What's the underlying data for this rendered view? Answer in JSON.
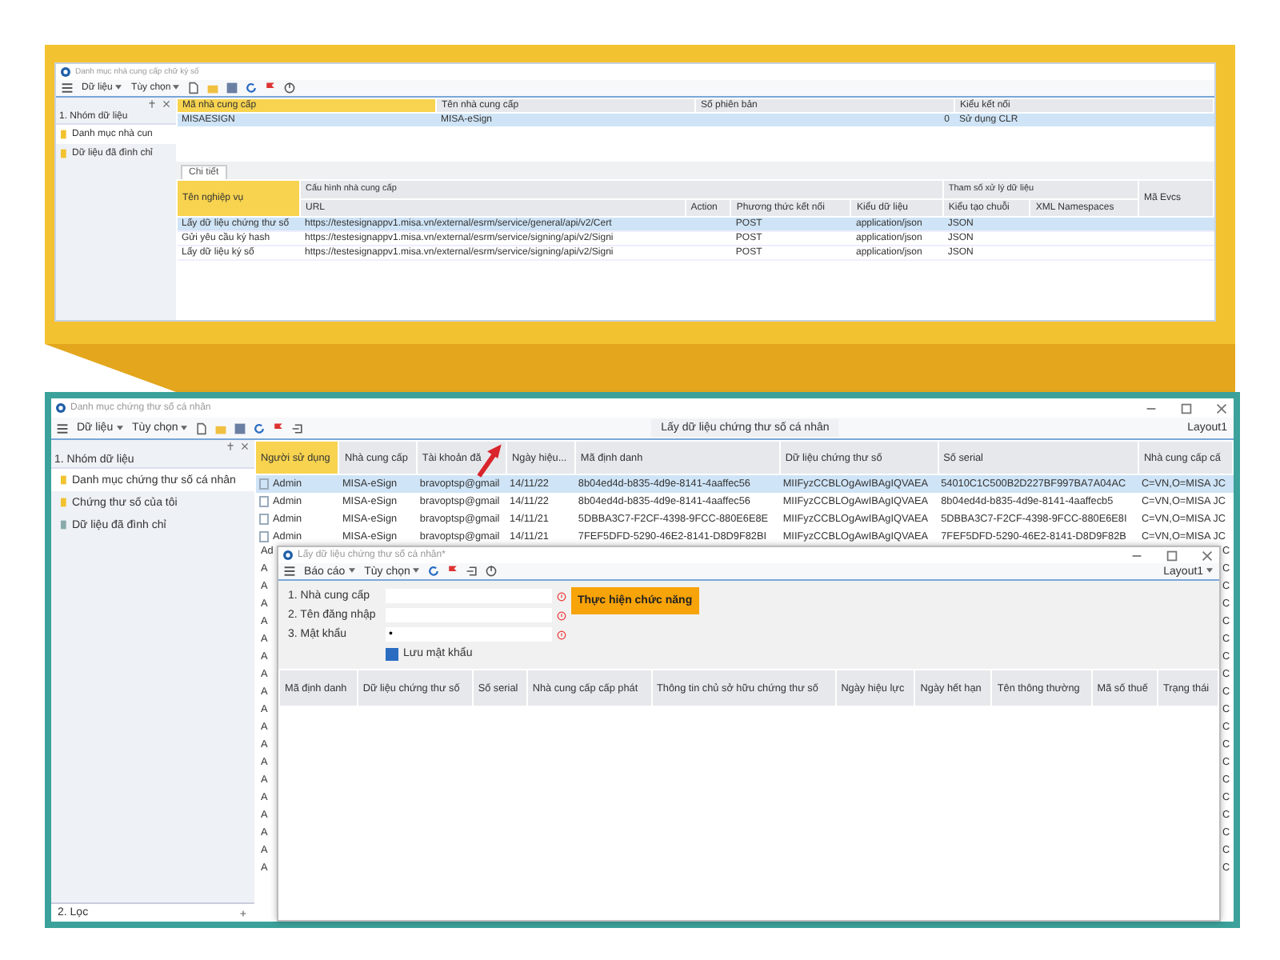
{
  "top_window": {
    "title": "Danh mục nhà cung cấp chữ ký số",
    "menu": [
      "Dữ liệu",
      "Tùy chọn"
    ],
    "sidebar": {
      "group": "1. Nhóm dữ liệu",
      "items": [
        {
          "label": "Danh mục nhà cun",
          "kind": "folder",
          "selected": true
        },
        {
          "label": "Dữ liệu đã đình chỉ",
          "kind": "folder",
          "selected": false
        }
      ]
    },
    "providers": {
      "columns": [
        {
          "label": "Mã nhà cung cấp",
          "highlighted": true
        },
        {
          "label": "Tên nhà cung cấp",
          "highlighted": false
        },
        {
          "label": "Số phiên bản",
          "highlighted": false
        },
        {
          "label": "Kiểu kết nối",
          "highlighted": false
        }
      ],
      "rows": [
        {
          "cells": [
            "MISAESIGN",
            "MISA-eSign",
            "0",
            "Sử dụng CLR"
          ],
          "selected": true
        }
      ]
    },
    "tab": {
      "label": "Chi tiết",
      "selected": true
    },
    "details": {
      "name_column": {
        "label": "Tên nghiệp vụ",
        "highlighted": true
      },
      "groups": [
        {
          "label": "Cấu hình nhà cung cấp",
          "columns": [
            "URL",
            "Action",
            "Phương thức kết nối",
            "Kiểu dữ liệu"
          ]
        },
        {
          "label": "Tham số xử lý dữ liệu",
          "columns": [
            "Kiểu tạo chuỗi",
            "XML Namespaces"
          ]
        }
      ],
      "code_column": "Mã Evcs",
      "rows": [
        {
          "name": "Lấy dữ liệu chứng thư số",
          "url": "https://testesignappv1.misa.vn/external/esrm/service/general/api/v2/Cert",
          "method": "POST",
          "data_type": "application/json",
          "string_type": "JSON",
          "selected": true
        },
        {
          "name": "Gửi yêu cầu ký hash",
          "url": "https://testesignappv1.misa.vn/external/esrm/service/signing/api/v2/Signi",
          "method": "POST",
          "data_type": "application/json",
          "string_type": "JSON",
          "selected": false
        },
        {
          "name": "Lấy dữ liệu ký số",
          "url": "https://testesignappv1.misa.vn/external/esrm/service/signing/api/v2/Signi",
          "method": "POST",
          "data_type": "application/json",
          "string_type": "JSON",
          "selected": false
        }
      ]
    }
  },
  "bottom_window": {
    "title": "Danh mục chứng thư số cá nhân",
    "menu": [
      "Dữ liệu",
      "Tùy chọn"
    ],
    "action": "Lấy dữ liệu chứng thư số cá nhân",
    "layout": "Layout1",
    "sidebar": {
      "group": "1. Nhóm dữ liệu",
      "items": [
        {
          "label": "Danh mục chứng thư số cá nhân",
          "kind": "folder",
          "selected": true
        },
        {
          "label": "Chứng thư số của tôi",
          "kind": "folder",
          "selected": false
        },
        {
          "label": "Dữ liệu đã đình chỉ",
          "kind": "suspended",
          "selected": false
        }
      ],
      "filter": "2. Lọc"
    },
    "grid": {
      "columns": [
        {
          "label": "Người sử dụng",
          "highlighted": true
        },
        {
          "label": "Nhà cung cấp",
          "highlighted": false
        },
        {
          "label": "Tài khoản đă",
          "highlighted": false
        },
        {
          "label": "Ngày hiệu...",
          "highlighted": false
        },
        {
          "label": "Mã định danh",
          "highlighted": false
        },
        {
          "label": "Dữ liệu chứng thư số",
          "highlighted": false
        },
        {
          "label": "Số serial",
          "highlighted": false
        },
        {
          "label": "Nhà cung cấp cấ",
          "highlighted": false
        }
      ],
      "rows": [
        {
          "cells": [
            "Admin",
            "MISA-eSign",
            "bravoptsp@gmail",
            "14/11/22",
            "8b04ed4d-b835-4d9e-8141-4aaffec56",
            "MIIFyzCCBLOgAwIBAgIQVAEA",
            "54010C1C500B2D227BF997BA7A04AC",
            "C=VN,O=MISA JC"
          ],
          "selected": true
        },
        {
          "cells": [
            "Admin",
            "MISA-eSign",
            "bravoptsp@gmail",
            "14/11/22",
            "8b04ed4d-b835-4d9e-8141-4aaffec56",
            "MIIFyzCCBLOgAwIBAgIQVAEA",
            "8b04ed4d-b835-4d9e-8141-4aaffecb5",
            "C=VN,O=MISA JC"
          ],
          "selected": false
        },
        {
          "cells": [
            "Admin",
            "MISA-eSign",
            "bravoptsp@gmail",
            "14/11/21",
            "5DBBA3C7-F2CF-4398-9FCC-880E6E8E",
            "MIIFyzCCBLOgAwIBAgIQVAEA",
            "5DBBA3C7-F2CF-4398-9FCC-880E6E8I",
            "C=VN,O=MISA JC"
          ],
          "selected": false
        },
        {
          "cells": [
            "Admin",
            "MISA-eSign",
            "bravoptsp@gmail",
            "14/11/21",
            "7FEF5DFD-5290-46E2-8141-D8D9F82BI",
            "MIIFyzCCBLOgAwIBAgIQVAEA",
            "7FEF5DFD-5290-46E2-8141-D8D9F82B",
            "C=VN,O=MISA JC"
          ],
          "selected": false
        }
      ],
      "covered_rows": [
        {
          "left": "Ad",
          "right": "C"
        },
        {
          "left": "A",
          "right": "C"
        },
        {
          "left": "A",
          "right": "C"
        },
        {
          "left": "A",
          "right": "C"
        },
        {
          "left": "A",
          "right": "C"
        },
        {
          "left": "A",
          "right": "C"
        },
        {
          "left": "A",
          "right": "C"
        },
        {
          "left": "A",
          "right": "C"
        },
        {
          "left": "A",
          "right": "C"
        },
        {
          "left": "A",
          "right": "C"
        },
        {
          "left": "A",
          "right": "C"
        },
        {
          "left": "A",
          "right": "C"
        },
        {
          "left": "A",
          "right": "C"
        },
        {
          "left": "A",
          "right": "C"
        },
        {
          "left": "A",
          "right": "C"
        },
        {
          "left": "A",
          "right": "C"
        },
        {
          "left": "A",
          "right": "C"
        },
        {
          "left": "A",
          "right": "C"
        },
        {
          "left": "A",
          "right": "C"
        }
      ]
    },
    "dialog": {
      "title": "Lấy dữ liệu chứng thư số cá nhân*",
      "menu": [
        "Báo cáo",
        "Tùy chọn"
      ],
      "layout": "Layout1",
      "fields": [
        {
          "label": "1. Nhà cung cấp"
        },
        {
          "label": "2. Tên đăng nhập"
        },
        {
          "label": "3. Mật khẩu",
          "value": "•"
        }
      ],
      "remember": {
        "label": "Lưu mật khẩu",
        "checked": true
      },
      "button": "Thực hiện chức năng",
      "columns": [
        "Mã định danh",
        "Dữ liệu chứng thư số",
        "Số serial",
        "Nhà cung cấp cấp phát",
        "Thông tin chủ sở hữu chứng thư số",
        "Ngày hiệu lực",
        "Ngày hết hạn",
        "Tên thông thường",
        "Mã số thuế",
        "Trạng thái"
      ]
    }
  }
}
